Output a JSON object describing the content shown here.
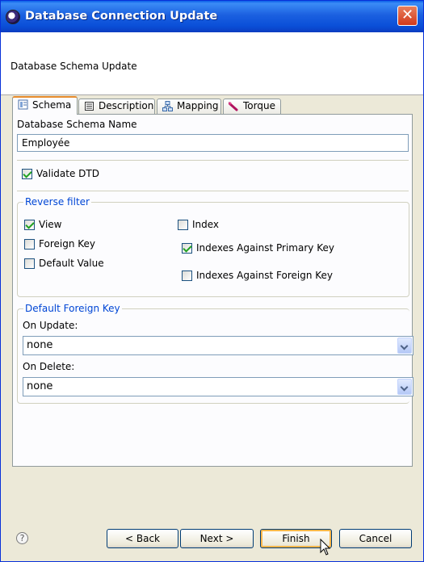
{
  "window": {
    "title": "Database Connection Update",
    "icon": "eclipse-app-icon"
  },
  "banner": {
    "subtitle": "Database Schema Update"
  },
  "tabs": [
    {
      "label": "Schema",
      "icon": "schema-icon",
      "active": true
    },
    {
      "label": "Description",
      "icon": "document-icon",
      "active": false
    },
    {
      "label": "Mapping",
      "icon": "mapping-icon",
      "active": false
    },
    {
      "label": "Torque",
      "icon": "torque-icon",
      "active": false
    }
  ],
  "schema_tab": {
    "name_label": "Database Schema Name",
    "name_value": "Employée",
    "validate_dtd": {
      "label": "Validate DTD",
      "checked": true
    },
    "reverse_filter": {
      "title": "Reverse filter",
      "view": {
        "label": "View",
        "checked": true
      },
      "foreign_key": {
        "label": "Foreign Key",
        "checked": false
      },
      "default_value": {
        "label": "Default Value",
        "checked": false
      },
      "index": {
        "label": "Index",
        "checked": false
      },
      "indexes_primary": {
        "label": "Indexes Against Primary Key",
        "checked": true
      },
      "indexes_foreign": {
        "label": "Indexes Against Foreign Key",
        "checked": false
      }
    },
    "default_foreign_key": {
      "title": "Default Foreign Key",
      "on_update_label": "On Update:",
      "on_update_value": "none",
      "on_delete_label": "On Delete:",
      "on_delete_value": "none"
    }
  },
  "buttons": {
    "back": "< Back",
    "next": "Next >",
    "finish": "Finish",
    "cancel": "Cancel"
  },
  "help_icon": "?",
  "colors": {
    "title_bar": "#0a5fe8",
    "group_title": "#0046d5",
    "check_mark": "#21a121",
    "dialog_bg": "#ece9d8"
  }
}
